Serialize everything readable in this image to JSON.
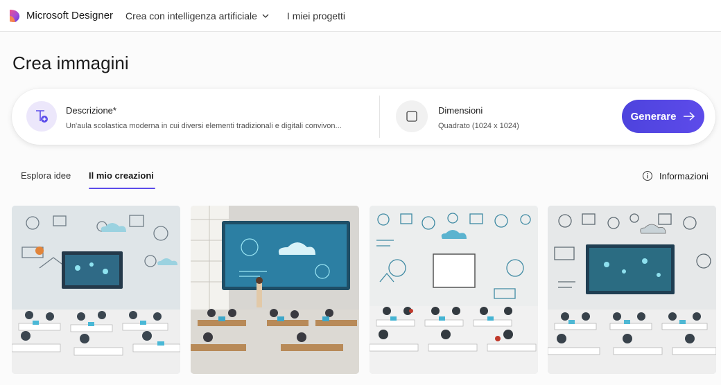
{
  "header": {
    "app_name": "Microsoft Designer",
    "nav": [
      {
        "label": "Crea con intelligenza artificiale",
        "has_dropdown": true
      },
      {
        "label": "I miei progetti",
        "has_dropdown": false
      }
    ]
  },
  "page_title": "Crea immagini",
  "prompt": {
    "description_label": "Descrizione*",
    "description_value": "Un'aula scolastica moderna in cui diversi elementi tradizionali e digitali convivon...",
    "dimensions_label": "Dimensioni",
    "dimensions_value": "Quadrato (1024 x 1024)",
    "generate_label": "Generare"
  },
  "tabs": [
    {
      "label": "Esplora idee",
      "active": false
    },
    {
      "label": "Il mio creazioni",
      "active": true
    }
  ],
  "info_label": "Informazioni",
  "gallery": {
    "count": 4,
    "items": [
      {
        "icon": "image-thumbnail"
      },
      {
        "icon": "image-thumbnail"
      },
      {
        "icon": "image-thumbnail"
      },
      {
        "icon": "image-thumbnail"
      }
    ]
  },
  "colors": {
    "accent": "#5b4bea",
    "button": "#4d43dd",
    "icon_bg": "#ece7fb"
  }
}
